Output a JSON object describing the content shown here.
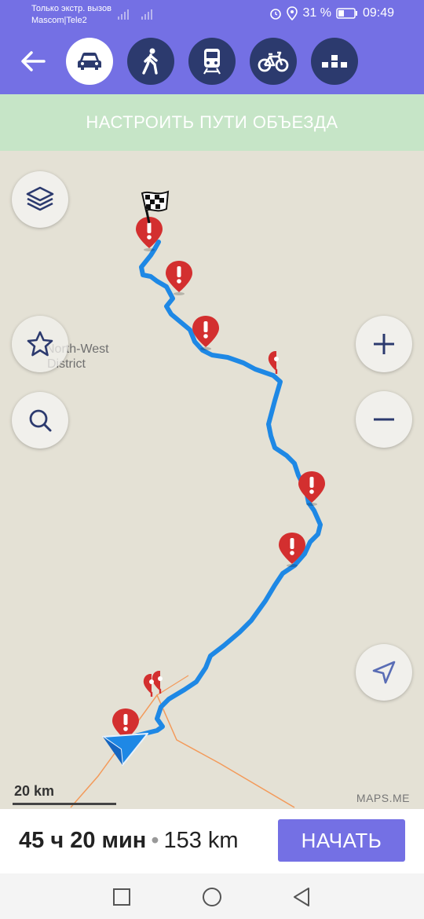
{
  "status": {
    "carrier_line1": "Только экстр. вызов",
    "carrier_line2": "Mascom|Tele2",
    "battery": "31 %",
    "time": "09:49"
  },
  "toolbar": {
    "modes": [
      "car-icon",
      "pedestrian-icon",
      "train-icon",
      "bicycle-icon",
      "taxi-icon"
    ],
    "active_mode": "car"
  },
  "banner": {
    "label": "НАСТРОИТЬ ПУТИ ОБЪЕЗДА"
  },
  "map": {
    "district_line1": "North-West",
    "district_line2": "District",
    "scale": "20 km",
    "attribution": "MAPS.ME"
  },
  "route": {
    "time": "45 ч 20 мин",
    "separator": "•",
    "distance": "153 km",
    "start_label": "НАЧАТЬ"
  },
  "colors": {
    "accent": "#7470e4",
    "route": "#1e88e5",
    "warning": "#d32f2f"
  }
}
